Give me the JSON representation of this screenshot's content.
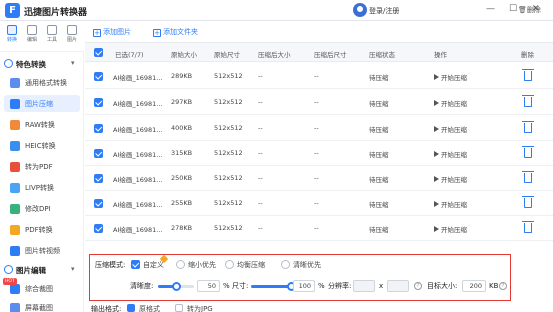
{
  "app": {
    "title": "迅捷图片转换器",
    "logo_glyph": "F",
    "login": "登录/注册",
    "minimize": "—",
    "maximize": "☐",
    "close": "✕"
  },
  "top_icons": [
    {
      "label": "转换",
      "active": true
    },
    {
      "label": "编辑",
      "active": false
    },
    {
      "label": "工具",
      "active": false
    },
    {
      "label": "图片",
      "active": false
    }
  ],
  "sidebar": {
    "section1": "特色转换",
    "section1_items": [
      "通用格式转换",
      "图片压缩",
      "RAW转换",
      "HEIC转换",
      "转为PDF",
      "LIVP转换",
      "修改DPI",
      "PDF转换",
      "图片转视频"
    ],
    "section2": "图片编辑",
    "section2_items": [
      "综合裁图",
      "屏幕截图"
    ],
    "hot_badge": "HOT",
    "active_item": "图片压缩"
  },
  "toolbar": {
    "add_image": "添加图片",
    "add_folder": "添加文件夹",
    "delete_all": "删除"
  },
  "table": {
    "headers": [
      "已选(7/7)",
      "原始大小",
      "原始尺寸",
      "压缩后大小",
      "压缩后尺寸",
      "压缩状态",
      "操作",
      "删除"
    ],
    "rows": [
      {
        "name": "AI绘画_16981...",
        "size": "289KB",
        "dims": "512x512",
        "csize": "--",
        "cdims": "--",
        "status": "待压缩",
        "action": "开始压缩"
      },
      {
        "name": "AI绘画_16981...",
        "size": "297KB",
        "dims": "512x512",
        "csize": "--",
        "cdims": "--",
        "status": "待压缩",
        "action": "开始压缩"
      },
      {
        "name": "AI绘画_16981...",
        "size": "400KB",
        "dims": "512x512",
        "csize": "--",
        "cdims": "--",
        "status": "待压缩",
        "action": "开始压缩"
      },
      {
        "name": "AI绘画_16981...",
        "size": "315KB",
        "dims": "512x512",
        "csize": "--",
        "cdims": "--",
        "status": "待压缩",
        "action": "开始压缩"
      },
      {
        "name": "AI绘画_16981...",
        "size": "250KB",
        "dims": "512x512",
        "csize": "--",
        "cdims": "--",
        "status": "待压缩",
        "action": "开始压缩"
      },
      {
        "name": "AI绘画_16981...",
        "size": "255KB",
        "dims": "512x512",
        "csize": "--",
        "cdims": "--",
        "status": "待压缩",
        "action": "开始压缩"
      },
      {
        "name": "AI绘画_16981...",
        "size": "278KB",
        "dims": "512x512",
        "csize": "--",
        "cdims": "--",
        "status": "待压缩",
        "action": "开始压缩"
      }
    ]
  },
  "settings": {
    "mode_label": "压缩模式:",
    "modes": [
      {
        "label": "自定义",
        "selected": true
      },
      {
        "label": "缩小优先",
        "selected": false
      },
      {
        "label": "均衡压缩",
        "selected": false
      },
      {
        "label": "清晰优先",
        "selected": false
      }
    ],
    "clarity_label": "清晰度:",
    "clarity_value": "50",
    "clarity_percent": 50,
    "pct": "%",
    "size_label": "尺寸:",
    "size_value": "100",
    "size_percent": 100,
    "resolution_label": "分辨率:",
    "x_sep": "x",
    "target_label": "目标大小:",
    "target_value": "200",
    "target_unit": "KB",
    "help": "?",
    "output_label": "输出格式:",
    "output_original": "原格式",
    "output_jpg": "转为JPG"
  },
  "colors": {
    "accent": "#2f7df6",
    "highlight_border": "#e53935"
  }
}
